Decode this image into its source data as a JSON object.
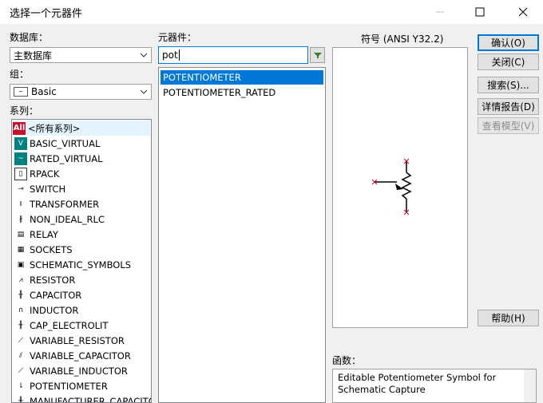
{
  "window": {
    "title": "选择一个元器件"
  },
  "database": {
    "label": "数据库：",
    "selected": "主数据库"
  },
  "group": {
    "label": "组：",
    "selected": "Basic"
  },
  "series": {
    "label": "系列：",
    "items": [
      {
        "name": "<所有系列>",
        "icon": "all-icon"
      },
      {
        "name": "BASIC_VIRTUAL",
        "icon": "basic-virtual-icon"
      },
      {
        "name": "RATED_VIRTUAL",
        "icon": "rated-virtual-icon"
      },
      {
        "name": "RPACK",
        "icon": "rpack-icon"
      },
      {
        "name": "SWITCH",
        "icon": "switch-icon"
      },
      {
        "name": "TRANSFORMER",
        "icon": "transformer-icon"
      },
      {
        "name": "NON_IDEAL_RLC",
        "icon": "non-ideal-rlc-icon"
      },
      {
        "name": "RELAY",
        "icon": "relay-icon"
      },
      {
        "name": "SOCKETS",
        "icon": "sockets-icon"
      },
      {
        "name": "SCHEMATIC_SYMBOLS",
        "icon": "schematic-symbols-icon"
      },
      {
        "name": "RESISTOR",
        "icon": "resistor-icon"
      },
      {
        "name": "CAPACITOR",
        "icon": "capacitor-icon"
      },
      {
        "name": "INDUCTOR",
        "icon": "inductor-icon"
      },
      {
        "name": "CAP_ELECTROLIT",
        "icon": "cap-electrolit-icon"
      },
      {
        "name": "VARIABLE_RESISTOR",
        "icon": "variable-resistor-icon"
      },
      {
        "name": "VARIABLE_CAPACITOR",
        "icon": "variable-capacitor-icon"
      },
      {
        "name": "VARIABLE_INDUCTOR",
        "icon": "variable-inductor-icon"
      },
      {
        "name": "POTENTIOMETER",
        "icon": "potentiometer-icon"
      },
      {
        "name": "MANUFACTURER_CAPACITOR",
        "icon": "manufacturer-capacitor-icon"
      }
    ]
  },
  "component": {
    "label": "元器件：",
    "search_value": "pot",
    "results": [
      "POTENTIOMETER",
      "POTENTIOMETER_RATED"
    ]
  },
  "symbol": {
    "label": "符号 (ANSI Y32.2)"
  },
  "function": {
    "label": "函数：",
    "text": "Editable Potentiometer Symbol for Schematic Capture"
  },
  "buttons": {
    "ok": "确认(O)",
    "close": "关闭(C)",
    "search": "搜索(S)...",
    "detail_report": "详情报告(D)",
    "view_model": "查看模型(V)",
    "help": "帮助(H)"
  },
  "colors": {
    "selection": "#0078d7",
    "accent_icon": "#008080",
    "all_icon": "#c8102e"
  }
}
